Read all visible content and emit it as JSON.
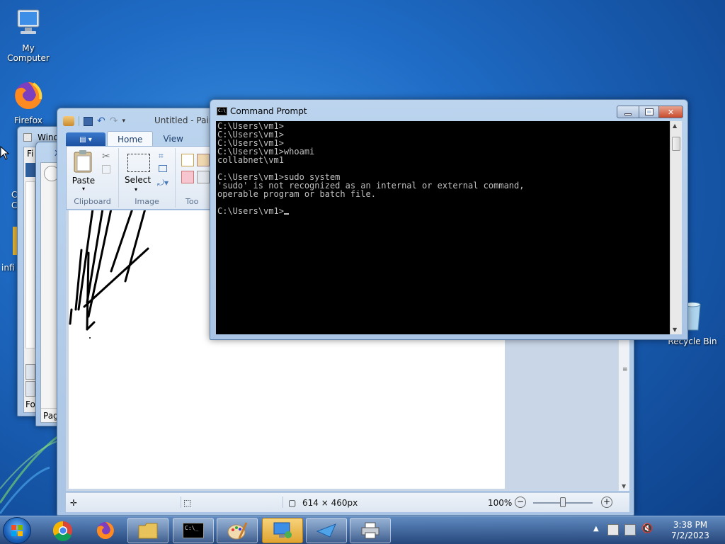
{
  "desktop": {
    "icons": [
      {
        "label": "My Computer"
      },
      {
        "label": "Firefox"
      },
      {
        "label": "Recycle Bin"
      }
    ],
    "partial_labels": [
      "C",
      "C",
      "infi"
    ]
  },
  "background_windows": {
    "win1_title": "Windo",
    "win1_menu": "Fi",
    "win1_bottom": "Fo",
    "win2_title": "X",
    "win2_bottom": "Page"
  },
  "paint": {
    "title": "Untitled - Paint",
    "tabs": [
      {
        "label": "Home"
      },
      {
        "label": "View"
      }
    ],
    "groups": {
      "clipboard": {
        "label": "Clipboard",
        "paste": "Paste"
      },
      "image": {
        "label": "Image",
        "select": "Select"
      },
      "tools": {
        "label": "Too"
      }
    },
    "status": {
      "size": "614 × 460px",
      "zoom": "100%"
    }
  },
  "cmd": {
    "title": "Command Prompt",
    "lines": [
      "C:\\Users\\vm1>",
      "C:\\Users\\vm1>",
      "C:\\Users\\vm1>",
      "C:\\Users\\vm1>whoami",
      "collabnet\\vm1",
      "",
      "C:\\Users\\vm1>sudo system",
      "'sudo' is not recognized as an internal or external command,",
      "operable program or batch file.",
      "",
      "C:\\Users\\vm1>"
    ]
  },
  "taskbar": {
    "time": "3:38 PM",
    "date": "7/2/2023"
  }
}
